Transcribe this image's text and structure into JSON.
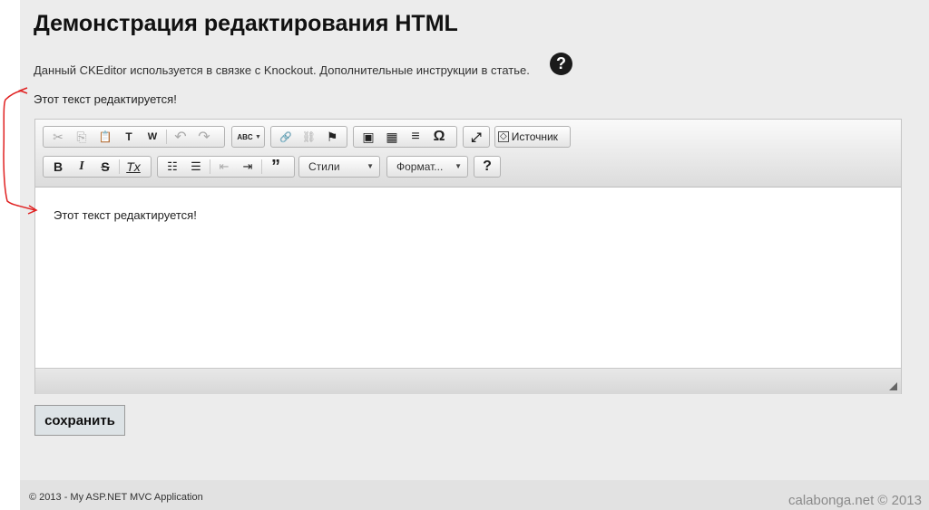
{
  "page": {
    "title": "Демонстрация редактирования HTML",
    "intro": "Данный CKEditor используется в связке с Knockout. Дополнительные инструкции в статье.",
    "help_icon_glyph": "?",
    "bound_text": "Этот текст редактируется!"
  },
  "editor": {
    "toolbar_row1": [
      {
        "name": "cut-icon",
        "glyph": "✂",
        "disabled": true
      },
      {
        "name": "copy-icon",
        "glyph": "⎘",
        "disabled": true
      },
      {
        "name": "paste-icon",
        "glyph": "📋",
        "disabled": false
      },
      {
        "name": "paste-text-icon",
        "glyph": "T",
        "disabled": false
      },
      {
        "name": "paste-word-icon",
        "glyph": "W",
        "disabled": false
      },
      {
        "name": "undo-icon",
        "glyph": "↶",
        "disabled": true
      },
      {
        "name": "redo-icon",
        "glyph": "↷",
        "disabled": true
      },
      {
        "name": "spellcheck-icon",
        "glyph": "ABC",
        "disabled": false
      },
      {
        "name": "link-icon",
        "glyph": "🔗",
        "disabled": false
      },
      {
        "name": "unlink-icon",
        "glyph": "⛓",
        "disabled": true
      },
      {
        "name": "anchor-icon",
        "glyph": "⚑",
        "disabled": false
      },
      {
        "name": "image-icon",
        "glyph": "▣",
        "disabled": false
      },
      {
        "name": "table-icon",
        "glyph": "▦",
        "disabled": false
      },
      {
        "name": "horizontal-rule-icon",
        "glyph": "≡",
        "disabled": false
      },
      {
        "name": "special-char-icon",
        "glyph": "Ω",
        "disabled": false
      },
      {
        "name": "maximize-icon",
        "glyph": "⤢",
        "disabled": false
      }
    ],
    "source_label": "Источник",
    "styles_label": "Стили",
    "format_label": "Формат...",
    "content_text": "Этот текст редактируется!"
  },
  "save_button": "сохранить",
  "footer": {
    "copyright": "© 2013 - My ASP.NET MVC Application",
    "watermark": "calabonga.net © 2013"
  },
  "colors": {
    "page_bg": "#ececec",
    "annotation": "#e02020"
  }
}
